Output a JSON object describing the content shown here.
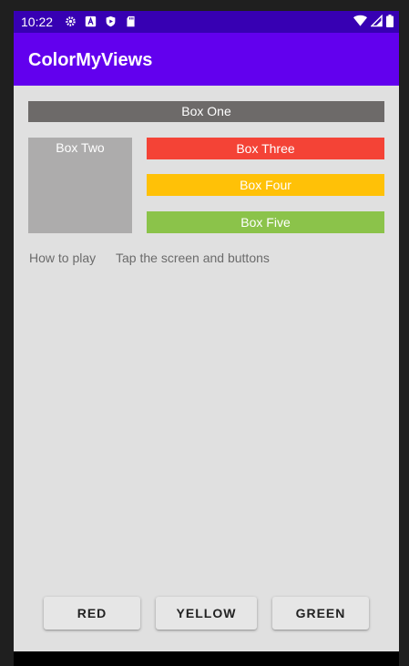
{
  "status_bar": {
    "time": "10:22",
    "icons": [
      "gear-icon",
      "a-icon",
      "shield-play-icon",
      "sd-card-icon",
      "wifi-icon",
      "signal-icon",
      "battery-icon"
    ]
  },
  "app_bar": {
    "title": "ColorMyViews"
  },
  "boxes": {
    "one": "Box One",
    "two": "Box Two",
    "three": "Box Three",
    "four": "Box Four",
    "five": "Box Five"
  },
  "info": {
    "label": "How to play",
    "text": "Tap the screen and buttons"
  },
  "buttons": {
    "red": "RED",
    "yellow": "YELLOW",
    "green": "GREEN"
  },
  "colors": {
    "status_bar": "#3700b3",
    "app_bar": "#6200ee",
    "background": "#e0e0e0",
    "box_one": "#6d6a69",
    "box_two": "#adacac",
    "box_three": "#f44336",
    "box_four": "#ffc107",
    "box_five": "#8bc34a"
  }
}
